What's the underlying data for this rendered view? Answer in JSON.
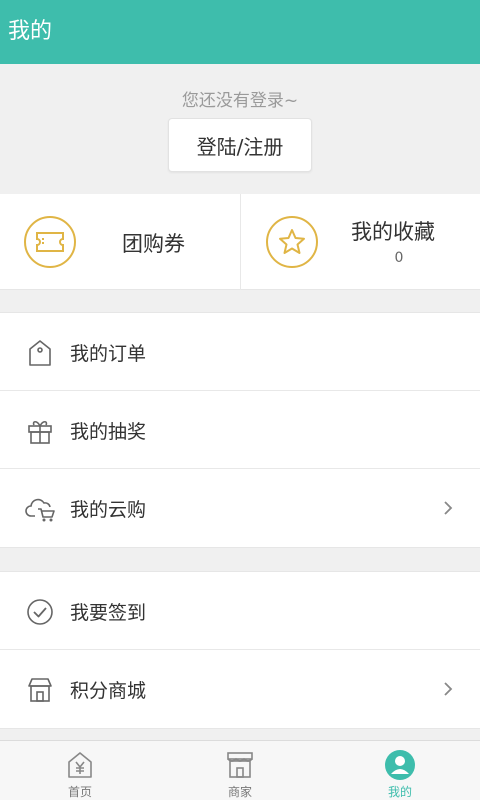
{
  "header": {
    "title": "我的"
  },
  "login": {
    "hint": "您还没有登录~",
    "button_label": "登陆/注册"
  },
  "quick_links": [
    {
      "label": "团购券",
      "icon": "ticket-icon"
    },
    {
      "label": "我的收藏",
      "count": "0",
      "icon": "star-icon"
    }
  ],
  "menu_group_1": [
    {
      "label": "我的订单",
      "icon": "tag-icon"
    },
    {
      "label": "我的抽奖",
      "icon": "gift-icon"
    },
    {
      "label": "我的云购",
      "icon": "cloud-cart-icon",
      "has_arrow": true
    }
  ],
  "menu_group_2": [
    {
      "label": "我要签到",
      "icon": "check-circle-icon"
    },
    {
      "label": "积分商城",
      "icon": "store-icon",
      "has_arrow": true
    }
  ],
  "tabbar": [
    {
      "label": "首页",
      "icon": "home-yuan-icon"
    },
    {
      "label": "商家",
      "icon": "shop-icon"
    },
    {
      "label": "我的",
      "icon": "user-icon",
      "active": true
    }
  ],
  "colors": {
    "accent": "#3ebdac",
    "gold": "#e0b545"
  }
}
